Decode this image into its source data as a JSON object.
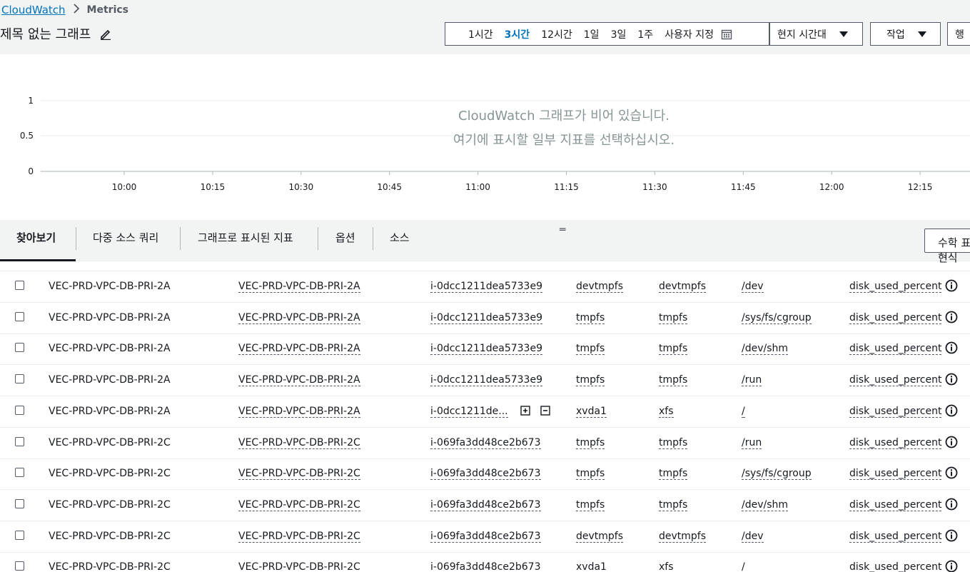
{
  "breadcrumb": {
    "root": "CloudWatch",
    "current": "Metrics"
  },
  "graph_title": "제목 없는 그래프",
  "time_range": {
    "options": [
      "1시간",
      "3시간",
      "12시간",
      "1일",
      "3일",
      "1주",
      "사용자 지정"
    ],
    "active": "3시간"
  },
  "timezone_label": "현지 시간대",
  "actions_label": "작업",
  "row_btn_label": "행",
  "empty_msg": {
    "line1": "CloudWatch 그래프가 비어 있습니다.",
    "line2": "여기에 표시할 일부 지표를 선택하십시오."
  },
  "chart_data": {
    "type": "line",
    "x_ticks": [
      "10:00",
      "10:15",
      "10:30",
      "10:45",
      "11:00",
      "11:15",
      "11:30",
      "11:45",
      "12:00",
      "12:15"
    ],
    "y_ticks": [
      "1",
      "0.5",
      "0"
    ],
    "ylim": [
      0,
      1
    ],
    "series": [],
    "grid": true
  },
  "tabs": [
    "찾아보기",
    "다중 소스 쿼리",
    "그래프로 표시된 지표",
    "옵션",
    "소스"
  ],
  "math_button": "수학 표현식",
  "metric_name": "disk_used_percent",
  "rows": [
    {
      "name": "VEC-PRD-VPC-DB-PRI-2A",
      "name_link": "VEC-PRD-VPC-DB-PRI-2A",
      "instance": "i-0dcc1211dea5733e9",
      "device": "devtmpfs",
      "fstype": "devtmpfs",
      "path": "/dev"
    },
    {
      "name": "VEC-PRD-VPC-DB-PRI-2A",
      "name_link": "VEC-PRD-VPC-DB-PRI-2A",
      "instance": "i-0dcc1211dea5733e9",
      "device": "tmpfs",
      "fstype": "tmpfs",
      "path": "/sys/fs/cgroup"
    },
    {
      "name": "VEC-PRD-VPC-DB-PRI-2A",
      "name_link": "VEC-PRD-VPC-DB-PRI-2A",
      "instance": "i-0dcc1211dea5733e9",
      "device": "tmpfs",
      "fstype": "tmpfs",
      "path": "/dev/shm"
    },
    {
      "name": "VEC-PRD-VPC-DB-PRI-2A",
      "name_link": "VEC-PRD-VPC-DB-PRI-2A",
      "instance": "i-0dcc1211dea5733e9",
      "device": "tmpfs",
      "fstype": "tmpfs",
      "path": "/run"
    },
    {
      "name": "VEC-PRD-VPC-DB-PRI-2A",
      "name_link": "VEC-PRD-VPC-DB-PRI-2A",
      "instance": "i-0dcc1211de...",
      "device": "xvda1",
      "fstype": "xfs",
      "path": "/"
    },
    {
      "name": "VEC-PRD-VPC-DB-PRI-2C",
      "name_link": "VEC-PRD-VPC-DB-PRI-2C",
      "instance": "i-069fa3dd48ce2b673",
      "device": "tmpfs",
      "fstype": "tmpfs",
      "path": "/run"
    },
    {
      "name": "VEC-PRD-VPC-DB-PRI-2C",
      "name_link": "VEC-PRD-VPC-DB-PRI-2C",
      "instance": "i-069fa3dd48ce2b673",
      "device": "tmpfs",
      "fstype": "tmpfs",
      "path": "/sys/fs/cgroup"
    },
    {
      "name": "VEC-PRD-VPC-DB-PRI-2C",
      "name_link": "VEC-PRD-VPC-DB-PRI-2C",
      "instance": "i-069fa3dd48ce2b673",
      "device": "tmpfs",
      "fstype": "tmpfs",
      "path": "/dev/shm"
    },
    {
      "name": "VEC-PRD-VPC-DB-PRI-2C",
      "name_link": "VEC-PRD-VPC-DB-PRI-2C",
      "instance": "i-069fa3dd48ce2b673",
      "device": "devtmpfs",
      "fstype": "devtmpfs",
      "path": "/dev"
    },
    {
      "name": "VEC-PRD-VPC-DB-PRI-2C",
      "name_link": "VEC-PRD-VPC-DB-PRI-2C",
      "instance": "i-069fa3dd48ce2b673",
      "device": "xvda1",
      "fstype": "xfs",
      "path": "/"
    }
  ]
}
